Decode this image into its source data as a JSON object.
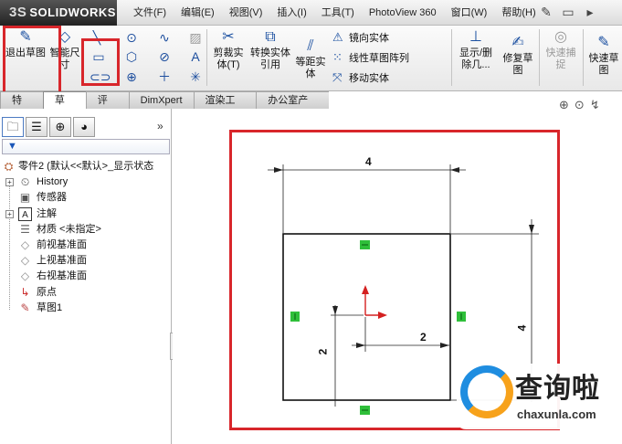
{
  "app": {
    "brand": "SOLIDWORKS",
    "brand_prefix": "3S"
  },
  "menu": [
    "文件(F)",
    "编辑(E)",
    "视图(V)",
    "插入(I)",
    "工具(T)",
    "PhotoView 360",
    "窗口(W)",
    "帮助(H)"
  ],
  "ribbon": {
    "exit_sketch": "退出草图",
    "smart_dimension": "智能尺寸",
    "trim": "剪裁实体(T)",
    "convert": "转换实体引用",
    "offset": "等距实体",
    "mirror": "镜向实体",
    "linear_pattern": "线性草图阵列",
    "move": "移动实体",
    "display_delete": "显示/删除几...",
    "repair": "修复草图",
    "quick_snap": "快速捕捉",
    "quick_sketch": "快速草图"
  },
  "tabs": [
    "特征",
    "草图",
    "评估",
    "DimXpert",
    "渲染工具",
    "办公室产品"
  ],
  "active_tab": 1,
  "tree": {
    "root": "零件2 (默认<<默认>_显示状态",
    "items": [
      "History",
      "传感器",
      "注解",
      "材质 <未指定>",
      "前视基准面",
      "上视基准面",
      "右视基准面",
      "原点",
      "草图1"
    ]
  },
  "sketch": {
    "width_dim": "4",
    "height_dim": "4",
    "offset_x_dim": "2",
    "offset_y_dim": "2"
  },
  "watermark": {
    "brand": "查询啦",
    "url": "chaxunla.com"
  },
  "colors": {
    "highlight_red": "#d8262b",
    "sketch_green": "#2fbf3a",
    "origin_red": "#d42020"
  }
}
